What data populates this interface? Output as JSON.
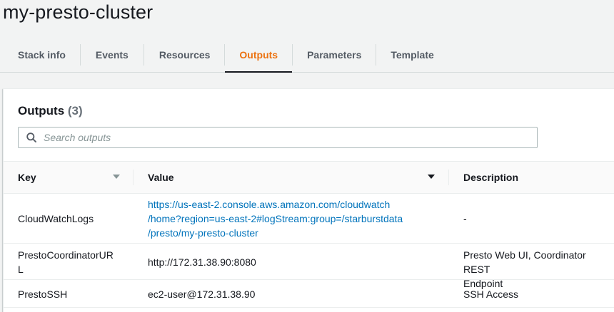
{
  "stack": {
    "title": "my-presto-cluster"
  },
  "tabs": [
    {
      "label": "Stack info"
    },
    {
      "label": "Events"
    },
    {
      "label": "Resources"
    },
    {
      "label": "Outputs",
      "active": true
    },
    {
      "label": "Parameters"
    },
    {
      "label": "Template"
    }
  ],
  "outputs": {
    "title": "Outputs",
    "count": "(3)",
    "search_placeholder": "Search outputs",
    "columns": {
      "key": "Key",
      "value": "Value",
      "description": "Description"
    },
    "rows": [
      {
        "key": "CloudWatchLogs",
        "value_lines": [
          "https://us-east-2.console.aws.amazon.com/cloudwatch",
          "/home?region=us-east-2#logStream:group=/starburstdata",
          "/presto/my-presto-cluster"
        ],
        "description": "-"
      },
      {
        "key_lines": [
          "PrestoCoordinatorUR",
          "L"
        ],
        "value": "http://172.31.38.90:8080",
        "description_lines": [
          "Presto Web UI, Coordinator REST",
          "Endpoint"
        ]
      },
      {
        "key": "PrestoSSH",
        "value": "ec2-user@172.31.38.90",
        "description": "SSH Access"
      }
    ]
  },
  "colors": {
    "accent": "#ec7211",
    "link": "#0073bb",
    "text": "#16191f",
    "muted": "#545b64"
  },
  "icons": {
    "search": "search-icon",
    "sort_key": "caret-down-icon",
    "sort_value": "caret-down-icon"
  }
}
